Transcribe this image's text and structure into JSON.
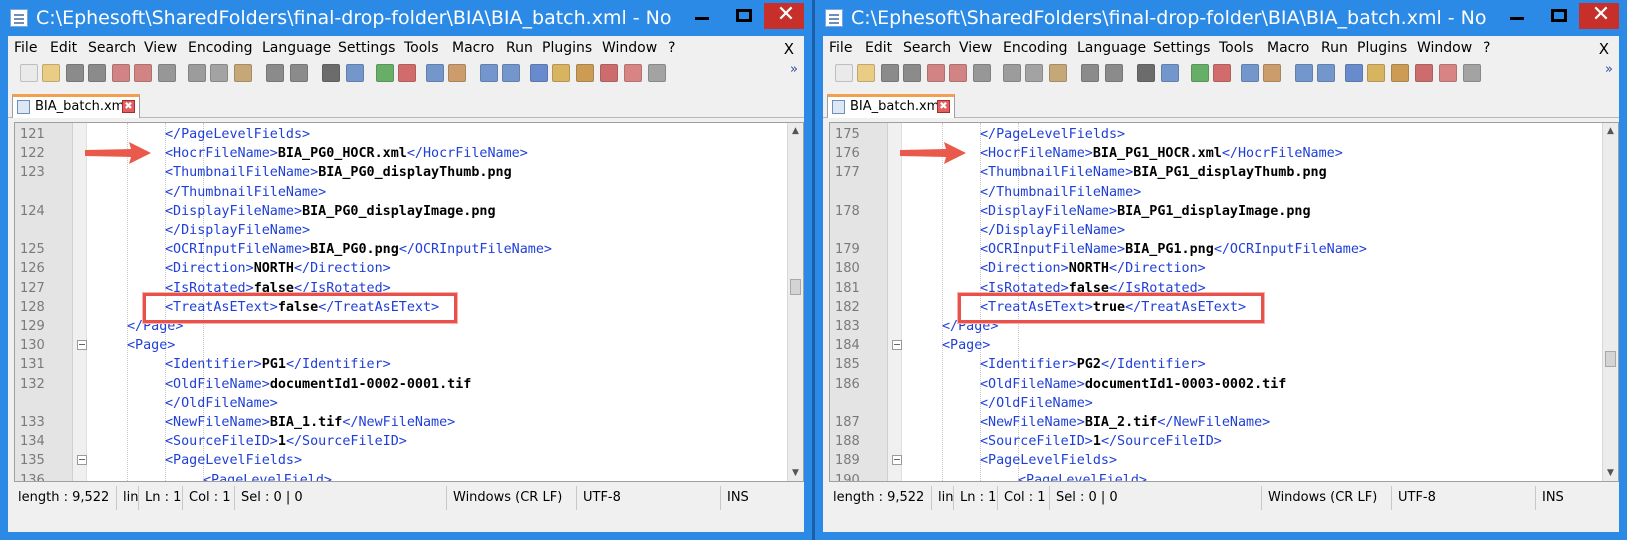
{
  "colors": {
    "titlebar": "#2b8ae6",
    "tag": "#1f3fd8",
    "highlight": "#e8524a",
    "arrow": "#ea5a4c"
  },
  "windows": [
    {
      "id": "left",
      "title": "C:\\Ephesoft\\SharedFolders\\final-drop-folder\\BIA\\BIA_batch.xml - Notepad++",
      "menu": [
        "File",
        "Edit",
        "Search",
        "View",
        "Encoding",
        "Language",
        "Settings",
        "Tools",
        "Macro",
        "Run",
        "Plugins",
        "Window",
        "?"
      ],
      "menu_close": "X",
      "tab_label": "BIA_batch.xml",
      "lines": [
        {
          "n": "121",
          "indent": 2,
          "parts": [
            [
              "t",
              "</PageLevelFields>"
            ]
          ]
        },
        {
          "n": "122",
          "indent": 2,
          "parts": [
            [
              "t",
              "<HocrFileName>"
            ],
            [
              "v",
              "BIA_PG0_HOCR.xml"
            ],
            [
              "t",
              "</HocrFileName>"
            ]
          ]
        },
        {
          "n": "123",
          "indent": 2,
          "parts": [
            [
              "t",
              "<ThumbnailFileName>"
            ],
            [
              "v",
              "BIA_PG0_displayThumb.png"
            ]
          ]
        },
        {
          "n": "",
          "indent": 2,
          "parts": [
            [
              "t",
              "</ThumbnailFileName>"
            ]
          ]
        },
        {
          "n": "124",
          "indent": 2,
          "parts": [
            [
              "t",
              "<DisplayFileName>"
            ],
            [
              "v",
              "BIA_PG0_displayImage.png"
            ]
          ]
        },
        {
          "n": "",
          "indent": 2,
          "parts": [
            [
              "t",
              "</DisplayFileName>"
            ]
          ]
        },
        {
          "n": "125",
          "indent": 2,
          "parts": [
            [
              "t",
              "<OCRInputFileName>"
            ],
            [
              "v",
              "BIA_PG0.png"
            ],
            [
              "t",
              "</OCRInputFileName>"
            ]
          ]
        },
        {
          "n": "126",
          "indent": 2,
          "parts": [
            [
              "t",
              "<Direction>"
            ],
            [
              "v",
              "NORTH"
            ],
            [
              "t",
              "</Direction>"
            ]
          ]
        },
        {
          "n": "127",
          "indent": 2,
          "parts": [
            [
              "t",
              "<IsRotated>"
            ],
            [
              "v",
              "false"
            ],
            [
              "t",
              "</IsRotated>"
            ]
          ]
        },
        {
          "n": "128",
          "indent": 2,
          "parts": [
            [
              "t",
              "<TreatAsEText>"
            ],
            [
              "v",
              "false"
            ],
            [
              "t",
              "</TreatAsEText>"
            ]
          ]
        },
        {
          "n": "129",
          "indent": 1,
          "parts": [
            [
              "t",
              "</Page>"
            ]
          ]
        },
        {
          "n": "130",
          "indent": 1,
          "fold": true,
          "parts": [
            [
              "t",
              "<Page>"
            ]
          ]
        },
        {
          "n": "131",
          "indent": 2,
          "parts": [
            [
              "t",
              "<Identifier>"
            ],
            [
              "v",
              "PG1"
            ],
            [
              "t",
              "</Identifier>"
            ]
          ]
        },
        {
          "n": "132",
          "indent": 2,
          "parts": [
            [
              "t",
              "<OldFileName>"
            ],
            [
              "v",
              "documentId1-0002-0001.tif"
            ]
          ]
        },
        {
          "n": "",
          "indent": 2,
          "parts": [
            [
              "t",
              "</OldFileName>"
            ]
          ]
        },
        {
          "n": "133",
          "indent": 2,
          "parts": [
            [
              "t",
              "<NewFileName>"
            ],
            [
              "v",
              "BIA_1.tif"
            ],
            [
              "t",
              "</NewFileName>"
            ]
          ]
        },
        {
          "n": "134",
          "indent": 2,
          "parts": [
            [
              "t",
              "<SourceFileID>"
            ],
            [
              "v",
              "1"
            ],
            [
              "t",
              "</SourceFileID>"
            ]
          ]
        },
        {
          "n": "135",
          "indent": 2,
          "fold": true,
          "parts": [
            [
              "t",
              "<PageLevelFields>"
            ]
          ]
        },
        {
          "n": "136",
          "indent": 3,
          "parts": [
            [
              "t",
              "<PageLevelField>"
            ]
          ]
        }
      ],
      "arrow_line": 1,
      "highlight_line": 9,
      "thumb_pos": 0.45,
      "status": {
        "length": "length : 9,522",
        "lines": "lin",
        "ln": "Ln : 1",
        "col": "Col : 1",
        "sel": "Sel : 0 | 0",
        "eol": "Windows (CR LF)",
        "enc": "UTF-8",
        "mode": "INS"
      }
    },
    {
      "id": "right",
      "title": "C:\\Ephesoft\\SharedFolders\\final-drop-folder\\BIA\\BIA_batch.xml - Notepad++",
      "menu": [
        "File",
        "Edit",
        "Search",
        "View",
        "Encoding",
        "Language",
        "Settings",
        "Tools",
        "Macro",
        "Run",
        "Plugins",
        "Window",
        "?"
      ],
      "menu_close": "X",
      "tab_label": "BIA_batch.xml",
      "lines": [
        {
          "n": "175",
          "indent": 2,
          "parts": [
            [
              "t",
              "</PageLevelFields>"
            ]
          ]
        },
        {
          "n": "176",
          "indent": 2,
          "parts": [
            [
              "t",
              "<HocrFileName>"
            ],
            [
              "v",
              "BIA_PG1_HOCR.xml"
            ],
            [
              "t",
              "</HocrFileName>"
            ]
          ]
        },
        {
          "n": "177",
          "indent": 2,
          "parts": [
            [
              "t",
              "<ThumbnailFileName>"
            ],
            [
              "v",
              "BIA_PG1_displayThumb.png"
            ]
          ]
        },
        {
          "n": "",
          "indent": 2,
          "parts": [
            [
              "t",
              "</ThumbnailFileName>"
            ]
          ]
        },
        {
          "n": "178",
          "indent": 2,
          "parts": [
            [
              "t",
              "<DisplayFileName>"
            ],
            [
              "v",
              "BIA_PG1_displayImage.png"
            ]
          ]
        },
        {
          "n": "",
          "indent": 2,
          "parts": [
            [
              "t",
              "</DisplayFileName>"
            ]
          ]
        },
        {
          "n": "179",
          "indent": 2,
          "parts": [
            [
              "t",
              "<OCRInputFileName>"
            ],
            [
              "v",
              "BIA_PG1.png"
            ],
            [
              "t",
              "</OCRInputFileName>"
            ]
          ]
        },
        {
          "n": "180",
          "indent": 2,
          "parts": [
            [
              "t",
              "<Direction>"
            ],
            [
              "v",
              "NORTH"
            ],
            [
              "t",
              "</Direction>"
            ]
          ]
        },
        {
          "n": "181",
          "indent": 2,
          "parts": [
            [
              "t",
              "<IsRotated>"
            ],
            [
              "v",
              "false"
            ],
            [
              "t",
              "</IsRotated>"
            ]
          ]
        },
        {
          "n": "182",
          "indent": 2,
          "parts": [
            [
              "t",
              "<TreatAsEText>"
            ],
            [
              "v",
              "true"
            ],
            [
              "t",
              "</TreatAsEText>"
            ]
          ]
        },
        {
          "n": "183",
          "indent": 1,
          "parts": [
            [
              "t",
              "</Page>"
            ]
          ]
        },
        {
          "n": "184",
          "indent": 1,
          "fold": true,
          "parts": [
            [
              "t",
              "<Page>"
            ]
          ]
        },
        {
          "n": "185",
          "indent": 2,
          "parts": [
            [
              "t",
              "<Identifier>"
            ],
            [
              "v",
              "PG2"
            ],
            [
              "t",
              "</Identifier>"
            ]
          ]
        },
        {
          "n": "186",
          "indent": 2,
          "parts": [
            [
              "t",
              "<OldFileName>"
            ],
            [
              "v",
              "documentId1-0003-0002.tif"
            ]
          ]
        },
        {
          "n": "",
          "indent": 2,
          "parts": [
            [
              "t",
              "</OldFileName>"
            ]
          ]
        },
        {
          "n": "187",
          "indent": 2,
          "parts": [
            [
              "t",
              "<NewFileName>"
            ],
            [
              "v",
              "BIA_2.tif"
            ],
            [
              "t",
              "</NewFileName>"
            ]
          ]
        },
        {
          "n": "188",
          "indent": 2,
          "parts": [
            [
              "t",
              "<SourceFileID>"
            ],
            [
              "v",
              "1"
            ],
            [
              "t",
              "</SourceFileID>"
            ]
          ]
        },
        {
          "n": "189",
          "indent": 2,
          "fold": true,
          "parts": [
            [
              "t",
              "<PageLevelFields>"
            ]
          ]
        },
        {
          "n": "190",
          "indent": 3,
          "parts": [
            [
              "t",
              "<PageLevelField>"
            ]
          ]
        }
      ],
      "arrow_line": 1,
      "highlight_line": 9,
      "thumb_pos": 0.68,
      "status": {
        "length": "length : 9,522",
        "lines": "lin",
        "ln": "Ln : 1",
        "col": "Col : 1",
        "sel": "Sel : 0 | 0",
        "eol": "Windows (CR LF)",
        "enc": "UTF-8",
        "mode": "INS"
      }
    }
  ]
}
